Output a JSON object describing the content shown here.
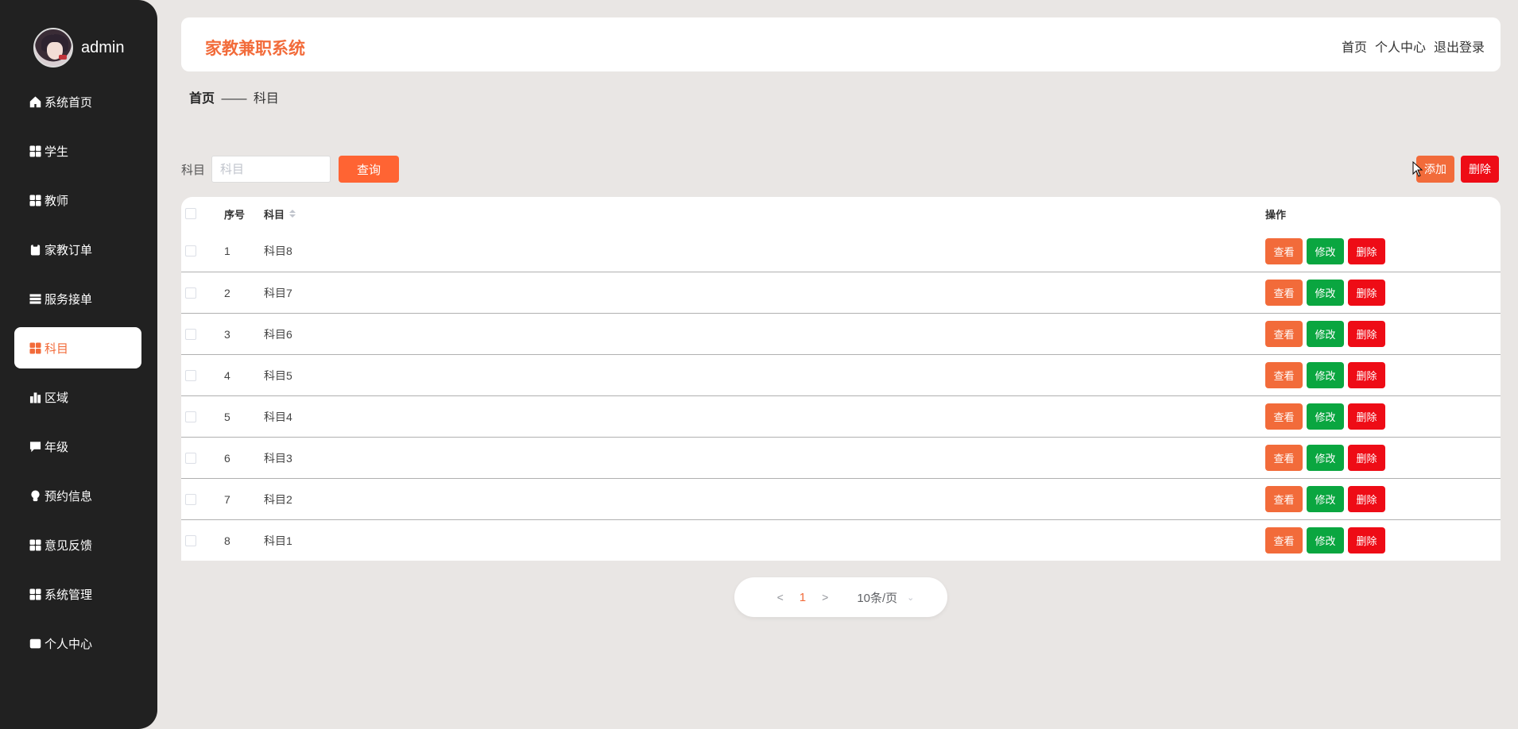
{
  "sidebar": {
    "username": "admin",
    "items": [
      {
        "label": "系统首页",
        "icon": "home-icon"
      },
      {
        "label": "学生",
        "icon": "grid-icon"
      },
      {
        "label": "教师",
        "icon": "grid-icon"
      },
      {
        "label": "家教订单",
        "icon": "clipboard-x-icon"
      },
      {
        "label": "服务接单",
        "icon": "list-icon"
      },
      {
        "label": "科目",
        "icon": "grid-icon",
        "active": true
      },
      {
        "label": "区域",
        "icon": "bar-chart-icon"
      },
      {
        "label": "年级",
        "icon": "chat-icon"
      },
      {
        "label": "预约信息",
        "icon": "lightbulb-icon"
      },
      {
        "label": "意见反馈",
        "icon": "grid-icon"
      },
      {
        "label": "系统管理",
        "icon": "grid-icon"
      },
      {
        "label": "个人中心",
        "icon": "card-icon"
      }
    ]
  },
  "header": {
    "brand": "家教兼职系统",
    "links": [
      "首页",
      "个人中心",
      "退出登录"
    ]
  },
  "breadcrumb": {
    "home": "首页",
    "separator": "——",
    "current": "科目"
  },
  "search": {
    "label": "科目",
    "placeholder": "科目",
    "value": "",
    "query_button": "查询"
  },
  "actions": {
    "add": "添加",
    "delete": "删除"
  },
  "table": {
    "columns": {
      "index": "序号",
      "name": "科目",
      "ops": "操作"
    },
    "rows": [
      {
        "index": "1",
        "name": "科目8"
      },
      {
        "index": "2",
        "name": "科目7"
      },
      {
        "index": "3",
        "name": "科目6"
      },
      {
        "index": "4",
        "name": "科目5"
      },
      {
        "index": "5",
        "name": "科目4"
      },
      {
        "index": "6",
        "name": "科目3"
      },
      {
        "index": "7",
        "name": "科目2"
      },
      {
        "index": "8",
        "name": "科目1"
      }
    ],
    "row_buttons": {
      "view": "查看",
      "edit": "修改",
      "delete": "删除"
    }
  },
  "pagination": {
    "prev": "<",
    "current": "1",
    "next": ">",
    "page_size": "10条/页"
  },
  "colors": {
    "accent": "#f26b3a",
    "sidebar_bg": "#212121",
    "edit": "#0aa640",
    "danger": "#ee0c16"
  }
}
